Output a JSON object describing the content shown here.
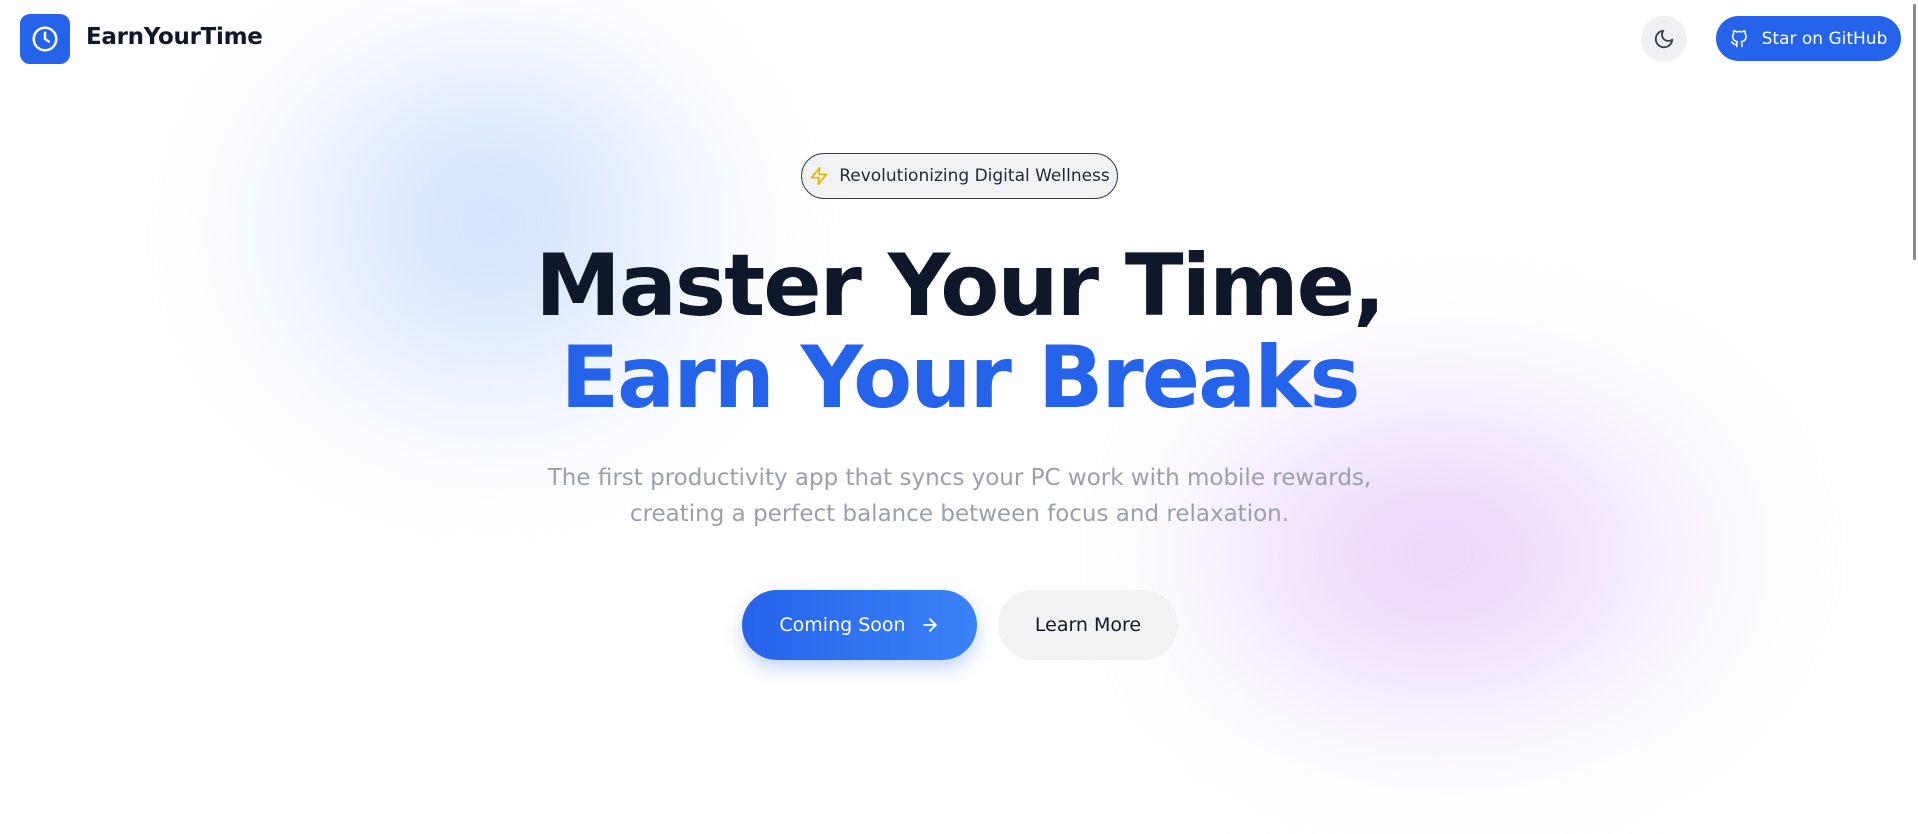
{
  "header": {
    "brand": "EarnYourTime",
    "theme_toggle_icon": "moon-icon",
    "github_button_label": "Star on GitHub",
    "github_icon": "github-icon",
    "logo_icon": "clock-icon"
  },
  "hero": {
    "badge_icon": "lightning-icon",
    "badge_label": "Revolutionizing Digital Wellness",
    "headline_line1": "Master Your Time,",
    "headline_line2": "Earn Your Breaks",
    "subtitle_line1": "The first productivity app that syncs your PC work with mobile rewards,",
    "subtitle_line2": "creating a perfect balance between focus and relaxation.",
    "primary_button_label": "Coming Soon",
    "primary_button_icon": "arrow-right-icon",
    "secondary_button_label": "Learn More"
  },
  "colors": {
    "accent": "#2563eb",
    "heading": "#0f172a",
    "muted_text": "#9aa0ab",
    "badge_icon": "#eab308"
  }
}
